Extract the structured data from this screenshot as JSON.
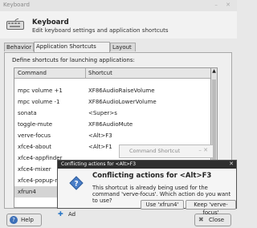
{
  "window": {
    "title": "Keyboard"
  },
  "header": {
    "title": "Keyboard",
    "subtitle": "Edit keyboard settings and application shortcuts"
  },
  "tabs": [
    {
      "label": "Behavior"
    },
    {
      "label": "Application Shortcuts"
    },
    {
      "label": "Layout"
    }
  ],
  "panel": {
    "label": "Define shortcuts for launching applications:"
  },
  "table": {
    "headers": [
      "Command",
      "Shortcut"
    ],
    "rows": [
      {
        "command": "mpc volume +1",
        "shortcut": "XF86AudioRaiseVolume"
      },
      {
        "command": "mpc volume -1",
        "shortcut": "XF86AudioLowerVolume"
      },
      {
        "command": "sonata",
        "shortcut": "<Super>s"
      },
      {
        "command": "toggle-mute",
        "shortcut": "XF86AudioMute"
      },
      {
        "command": "verve-focus",
        "shortcut": "<Alt>F3"
      },
      {
        "command": "xfce4-about",
        "shortcut": "<Alt>F1"
      },
      {
        "command": "xfce4-appfinder",
        "shortcut": ""
      },
      {
        "command": "xfce4-mixer",
        "shortcut": ""
      },
      {
        "command": "xfce4-popup-no",
        "shortcut": ""
      },
      {
        "command": "xfrun4",
        "shortcut": ""
      }
    ]
  },
  "buttons": {
    "add": "Ad",
    "help": "Help",
    "close": "Close"
  },
  "command_window": {
    "title": "Command Shortcut"
  },
  "dialog": {
    "title_bar": "Conflicting actions for <Alt>F3",
    "heading": "Conflicting actions for <Alt>F3",
    "message": "This shortcut is already being used for the command 'verve-focus'. Which action do you want to use?",
    "btn_use": "Use 'xfrun4'",
    "btn_keep": "Keep 'verve-focus'"
  },
  "colors": {
    "accent": "#3c6fb8",
    "dialog_titlebar": "#2f2f2f"
  }
}
